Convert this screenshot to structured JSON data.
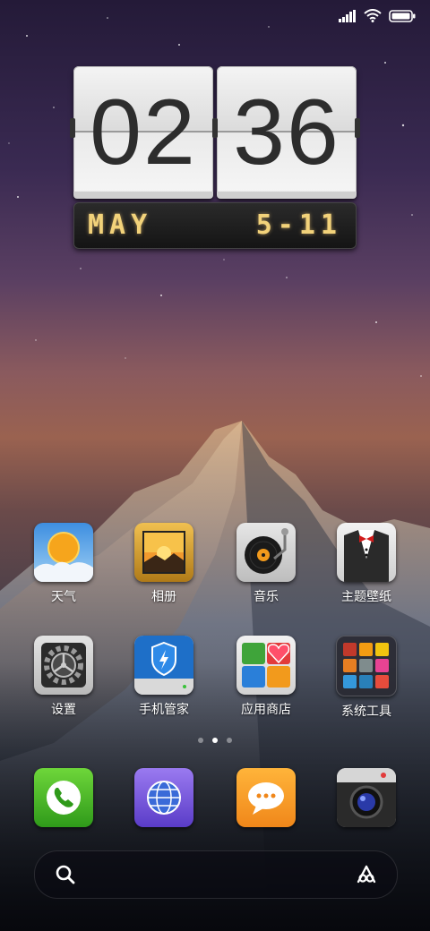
{
  "status_bar": {
    "signal_icon": "signal-icon",
    "wifi_icon": "wifi-icon",
    "battery_icon": "battery-icon"
  },
  "clock_widget": {
    "hours": "02",
    "minutes": "36",
    "month": "MAY",
    "date": "5-11"
  },
  "apps_row1": [
    {
      "label": "天气",
      "icon": "weather-icon"
    },
    {
      "label": "相册",
      "icon": "gallery-icon"
    },
    {
      "label": "音乐",
      "icon": "music-icon"
    },
    {
      "label": "主题壁纸",
      "icon": "themes-icon"
    }
  ],
  "apps_row2": [
    {
      "label": "设置",
      "icon": "settings-icon"
    },
    {
      "label": "手机管家",
      "icon": "security-icon"
    },
    {
      "label": "应用商店",
      "icon": "app-store-icon"
    },
    {
      "label": "系统工具",
      "icon": "tools-folder-icon"
    }
  ],
  "page_indicator": {
    "count": 3,
    "active": 1
  },
  "dock": [
    {
      "icon": "phone-icon"
    },
    {
      "icon": "browser-icon"
    },
    {
      "icon": "messages-icon"
    },
    {
      "icon": "camera-icon"
    }
  ],
  "search_bar": {
    "left_icon": "search-icon",
    "right_icon": "assistant-icon"
  }
}
